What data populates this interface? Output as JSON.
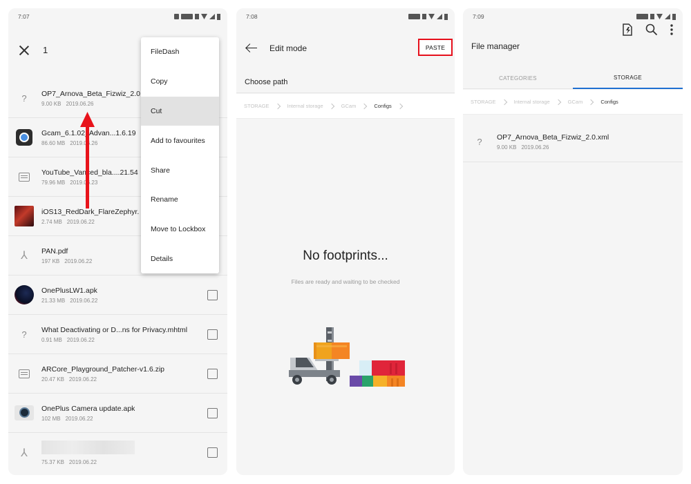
{
  "panel1": {
    "time": "7:07",
    "selection_count": "1",
    "files": [
      {
        "name": "OP7_Arnova_Beta_Fizwiz_2.0",
        "size": "9.00 KB",
        "date": "2019.06.26",
        "icon": "unknown-file-icon"
      },
      {
        "name": "Gcam_6.1.02_Advan...1.6.19",
        "size": "86.60 MB",
        "date": "2019.06.26",
        "icon": "camera-app-icon"
      },
      {
        "name": "YouTube_Vanced_bla....21.54",
        "size": "79.96 MB",
        "date": "2019.06.23",
        "icon": "archive-icon"
      },
      {
        "name": "iOS13_RedDark_FlareZephyr.",
        "size": "2.74 MB",
        "date": "2019.06.22",
        "icon": "image-thumbnail"
      },
      {
        "name": "PAN.pdf",
        "size": "197 KB",
        "date": "2019.06.22",
        "icon": "pdf-icon"
      },
      {
        "name": "OnePlusLW1.apk",
        "size": "21.33 MB",
        "date": "2019.06.22",
        "icon": "apk-icon"
      },
      {
        "name": "What Deactivating or D...ns for Privacy.mhtml",
        "size": "0.91 MB",
        "date": "2019.06.22",
        "icon": "unknown-file-icon"
      },
      {
        "name": "ARCore_Playground_Patcher-v1.6.zip",
        "size": "20.47 KB",
        "date": "2019.06.22",
        "icon": "archive-icon"
      },
      {
        "name": "OnePlus Camera update.apk",
        "size": "102 MB",
        "date": "2019.06.22",
        "icon": "camera-apk-icon"
      },
      {
        "name": "",
        "size": "75.37 KB",
        "date": "2019.06.22",
        "icon": "pdf-icon"
      }
    ],
    "menu": [
      "FileDash",
      "Copy",
      "Cut",
      "Add to favourites",
      "Share",
      "Rename",
      "Move to Lockbox",
      "Details"
    ],
    "menu_active": "Cut"
  },
  "panel2": {
    "time": "7:08",
    "title": "Edit mode",
    "paste_label": "PASTE",
    "choose_path": "Choose path",
    "breadcrumbs": [
      "STORAGE",
      "Internal storage",
      "GCam",
      "Configs"
    ],
    "empty_title": "No footprints...",
    "empty_subtitle": "Files are ready and waiting to be checked"
  },
  "panel3": {
    "time": "7:09",
    "title": "File manager",
    "tabs": [
      "CATEGORIES",
      "STORAGE"
    ],
    "active_tab": "STORAGE",
    "breadcrumbs": [
      "STORAGE",
      "Internal storage",
      "GCam",
      "Configs"
    ],
    "file": {
      "name": "OP7_Arnova_Beta_Fizwiz_2.0.xml",
      "size": "9.00 KB",
      "date": "2019.06.26",
      "icon": "unknown-file-icon"
    }
  },
  "colors": {
    "highlight_red": "#e60f1b",
    "tab_accent": "#1f6fd1",
    "menu_active_bg": "#e2e2e2"
  }
}
